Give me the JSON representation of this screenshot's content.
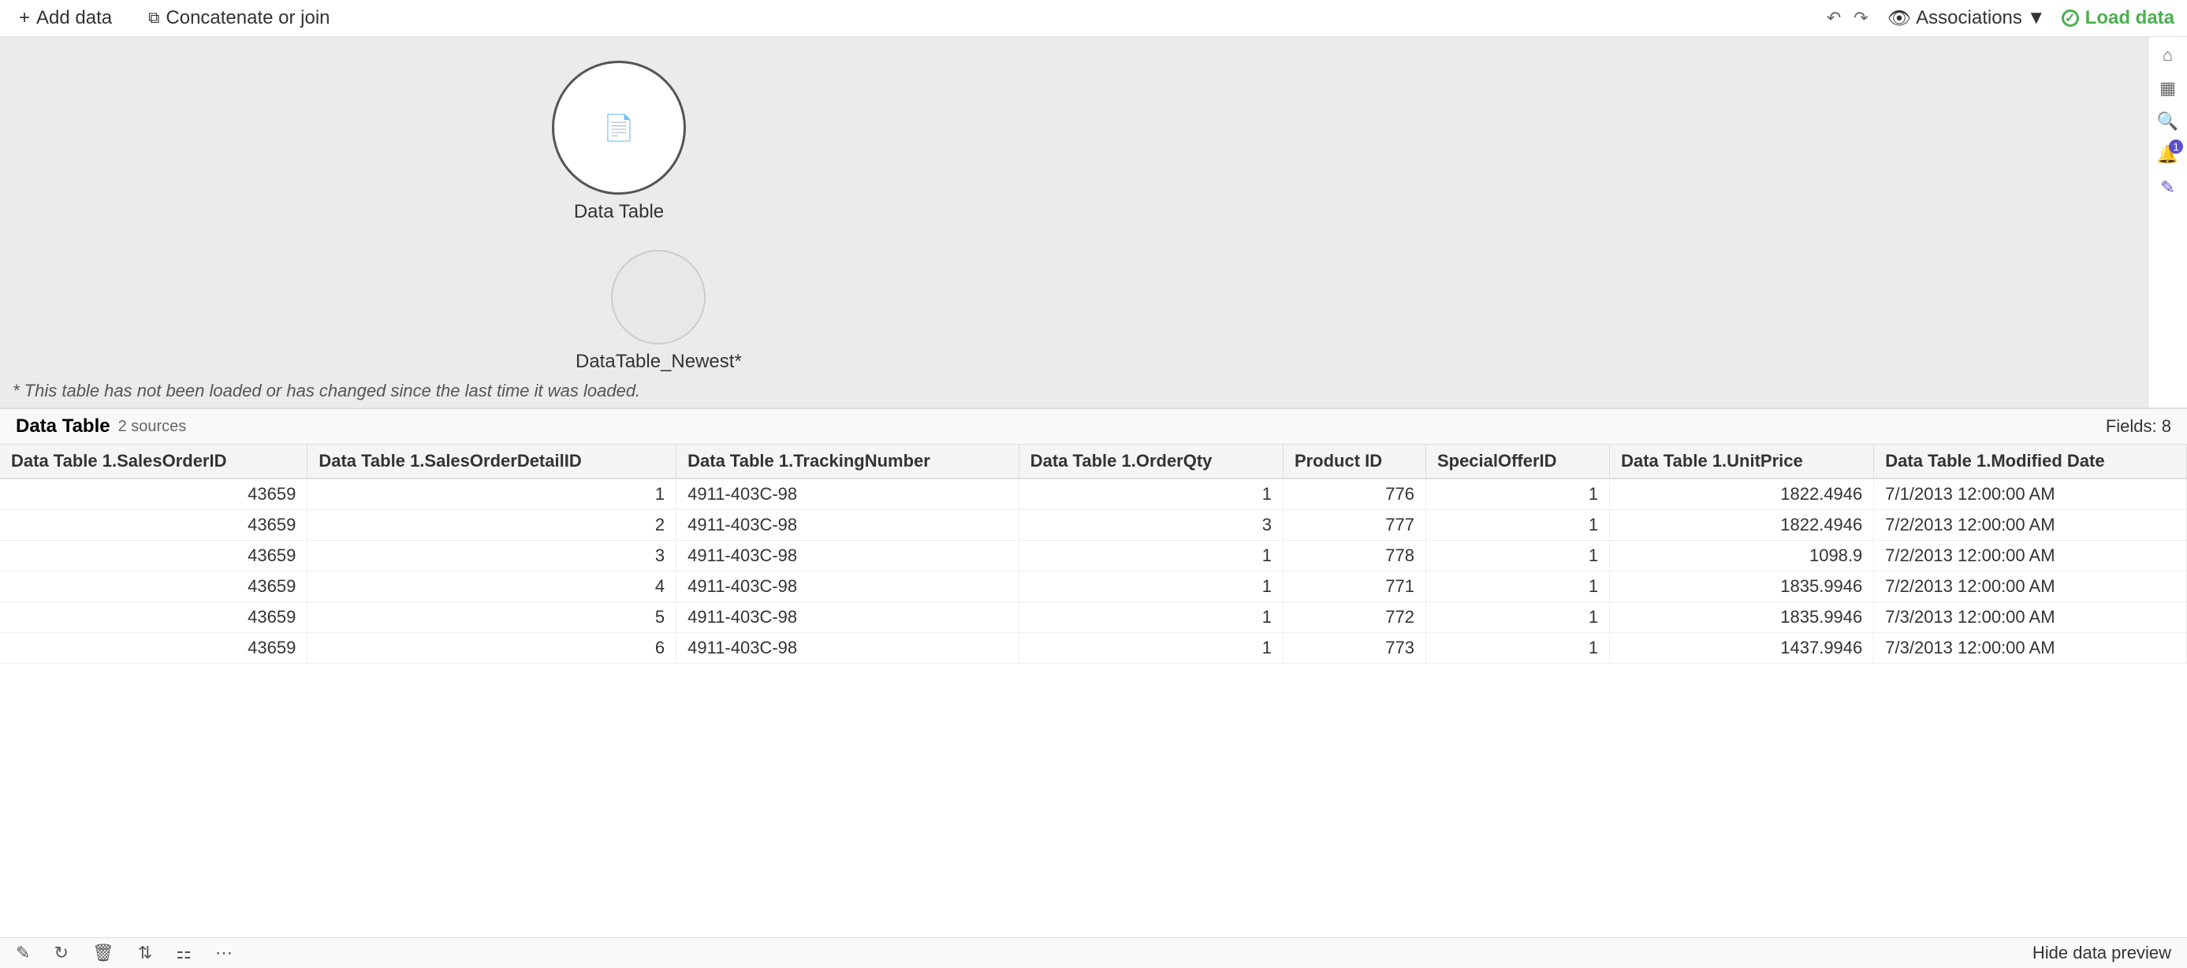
{
  "toolbar": {
    "add_data_label": "Add data",
    "concat_join_label": "Concatenate or join",
    "associations_label": "Associations",
    "load_data_label": "Load data"
  },
  "canvas": {
    "node1": {
      "label": "Data Table",
      "type": "filled"
    },
    "node2": {
      "label": "DataTable_Newest*",
      "type": "light"
    },
    "warning": "* This table has not been loaded or has changed since the last time it was loaded."
  },
  "data_panel": {
    "title": "Data Table",
    "sources": "2 sources",
    "fields_count": "Fields: 8",
    "columns": [
      "Data Table 1.SalesOrderID",
      "Data Table 1.SalesOrderDetailID",
      "Data Table 1.TrackingNumber",
      "Data Table 1.OrderQty",
      "Product ID",
      "SpecialOfferID",
      "Data Table 1.UnitPrice",
      "Data Table 1.Modified Date"
    ],
    "rows": [
      [
        "43659",
        "1",
        "4911-403C-98",
        "1",
        "776",
        "1",
        "1822.4946",
        "7/1/2013 12:00:00 AM"
      ],
      [
        "43659",
        "2",
        "4911-403C-98",
        "3",
        "777",
        "1",
        "1822.4946",
        "7/2/2013 12:00:00 AM"
      ],
      [
        "43659",
        "3",
        "4911-403C-98",
        "1",
        "778",
        "1",
        "1098.9",
        "7/2/2013 12:00:00 AM"
      ],
      [
        "43659",
        "4",
        "4911-403C-98",
        "1",
        "771",
        "1",
        "1835.9946",
        "7/2/2013 12:00:00 AM"
      ],
      [
        "43659",
        "5",
        "4911-403C-98",
        "1",
        "772",
        "1",
        "1835.9946",
        "7/3/2013 12:00:00 AM"
      ],
      [
        "43659",
        "6",
        "4911-403C-98",
        "1",
        "773",
        "1",
        "1437.9946",
        "7/3/2013 12:00:00 AM"
      ]
    ]
  },
  "bottom_toolbar": {
    "edit_tooltip": "Edit",
    "refresh_tooltip": "Refresh",
    "delete_tooltip": "Delete",
    "transform_tooltip": "Transform",
    "filter_tooltip": "Filter",
    "more_tooltip": "More",
    "hide_preview_label": "Hide data preview"
  },
  "right_sidebar": {
    "home_tooltip": "Home",
    "grid_tooltip": "Grid",
    "search_tooltip": "Search",
    "notification_badge": "1",
    "pen_tooltip": "Edit"
  }
}
